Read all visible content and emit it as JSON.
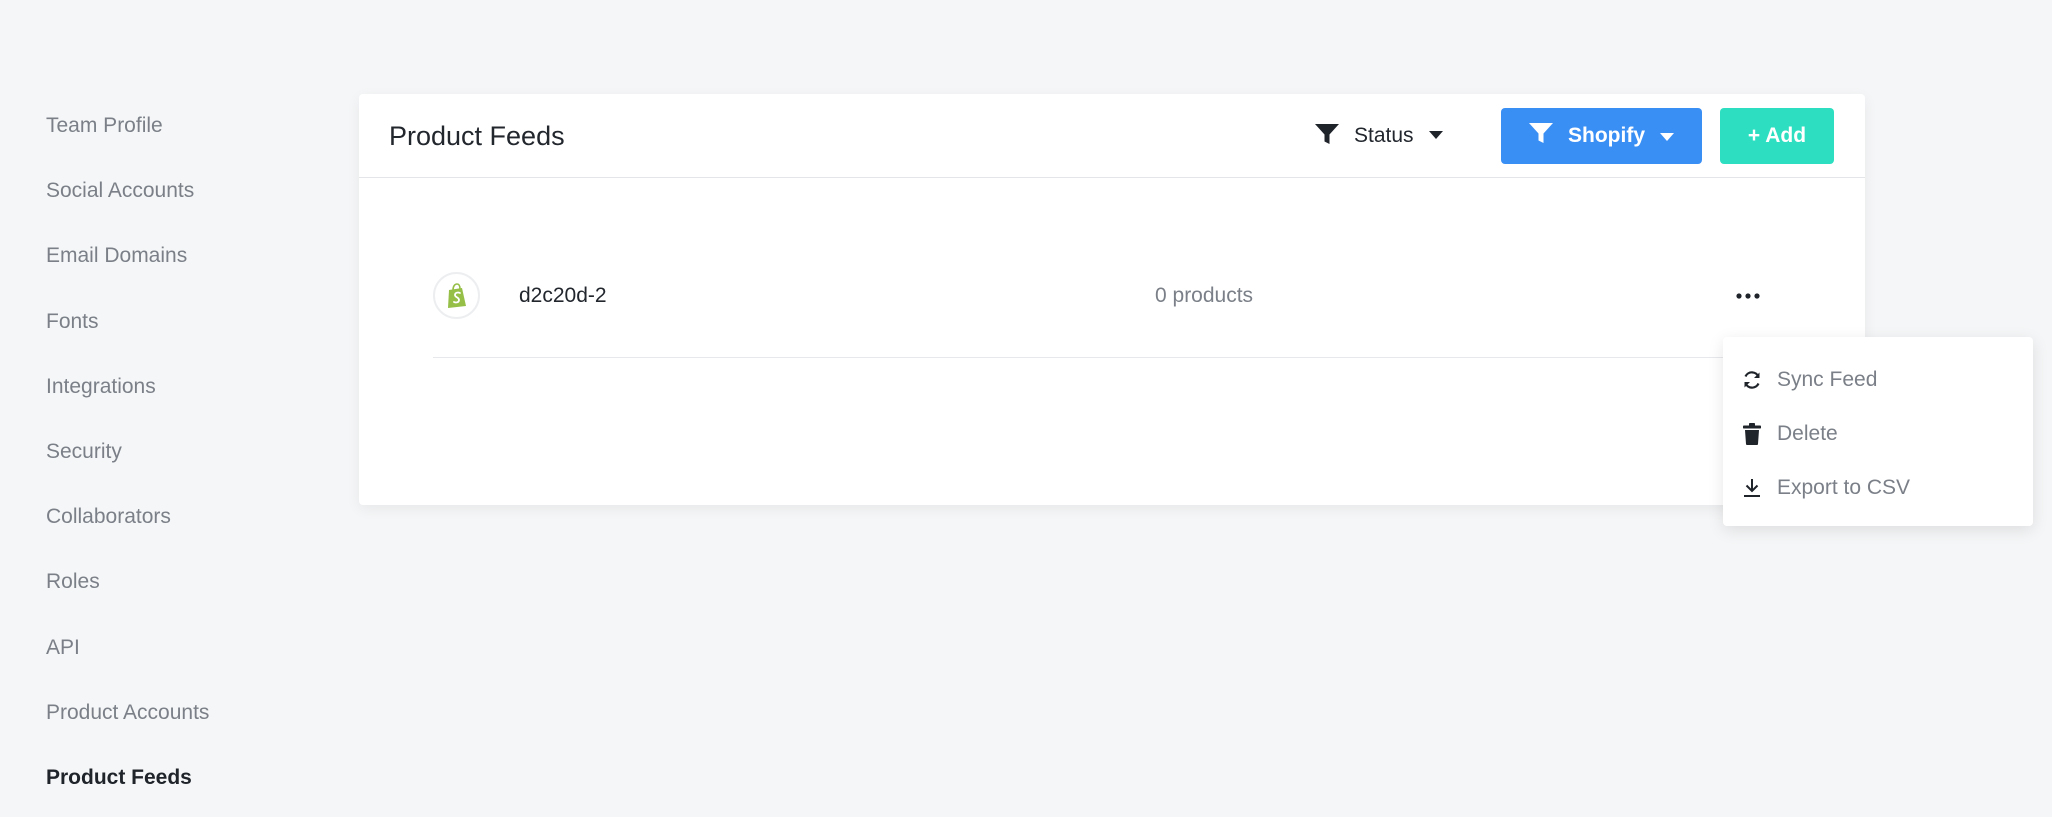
{
  "sidebar": {
    "items": [
      {
        "label": "Team Profile"
      },
      {
        "label": "Social Accounts"
      },
      {
        "label": "Email Domains"
      },
      {
        "label": "Fonts"
      },
      {
        "label": "Integrations"
      },
      {
        "label": "Security"
      },
      {
        "label": "Collaborators"
      },
      {
        "label": "Roles"
      },
      {
        "label": "API"
      },
      {
        "label": "Product Accounts"
      },
      {
        "label": "Product Feeds",
        "active": true
      }
    ]
  },
  "header": {
    "title": "Product Feeds",
    "status_filter_label": "Status",
    "platform_filter_label": "Shopify",
    "add_label": "+ Add"
  },
  "feeds": [
    {
      "name": "d2c20d-2",
      "count": "0 products",
      "icon": "shopify-logo"
    }
  ],
  "menu": {
    "items": [
      {
        "label": "Sync Feed",
        "icon": "sync-icon"
      },
      {
        "label": "Delete",
        "icon": "trash-icon"
      },
      {
        "label": "Export to CSV",
        "icon": "download-icon"
      }
    ]
  },
  "colors": {
    "shopify_button": "#3a8ff5",
    "add_button": "#2ddfc0",
    "shopify_green": "#95bf47"
  }
}
